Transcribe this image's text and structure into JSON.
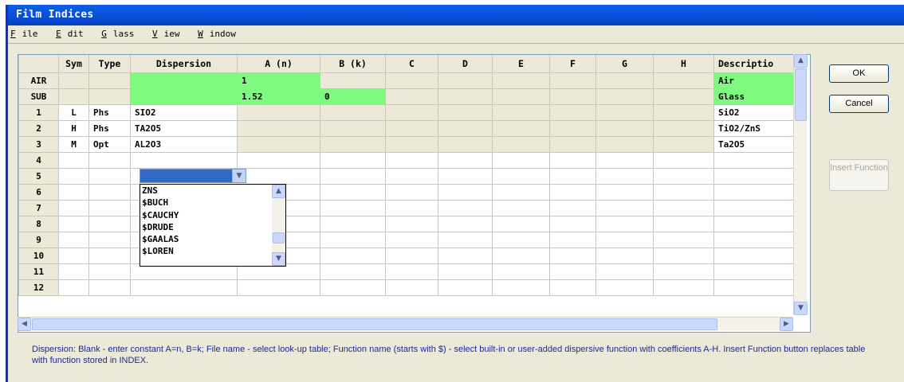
{
  "window": {
    "title": "Film Indices"
  },
  "menu": [
    {
      "key": "F",
      "rest": "ile"
    },
    {
      "key": "E",
      "rest": "dit"
    },
    {
      "key": "G",
      "rest": "lass"
    },
    {
      "key": "V",
      "rest": "iew"
    },
    {
      "key": "W",
      "rest": "indow"
    }
  ],
  "table": {
    "headers": [
      "",
      "Sym",
      "Type",
      "Dispersion",
      "A (n)",
      "B (k)",
      "C",
      "D",
      "E",
      "F",
      "G",
      "H",
      "Descriptio"
    ],
    "rows": [
      {
        "label": "AIR",
        "sym": "",
        "type": "",
        "dispersion": "",
        "a": "1",
        "b": "",
        "desc": "Air"
      },
      {
        "label": "SUB",
        "sym": "",
        "type": "",
        "dispersion": "",
        "a": "1.52",
        "b": "0",
        "desc": "Glass"
      },
      {
        "label": "1",
        "sym": "L",
        "type": "Phs",
        "dispersion": "SIO2",
        "a": "",
        "b": "",
        "desc": "SiO2"
      },
      {
        "label": "2",
        "sym": "H",
        "type": "Phs",
        "dispersion": "TA2O5",
        "a": "",
        "b": "",
        "desc": "TiO2/ZnS"
      },
      {
        "label": "3",
        "sym": "M",
        "type": "Opt",
        "dispersion": "AL2O3",
        "a": "",
        "b": "",
        "desc": "Ta2O5"
      },
      {
        "label": "4",
        "sym": "",
        "type": "",
        "dispersion": "",
        "a": "",
        "b": "",
        "desc": ""
      },
      {
        "label": "5",
        "sym": "",
        "type": "",
        "dispersion": "",
        "a": "",
        "b": "",
        "desc": ""
      },
      {
        "label": "6",
        "sym": "",
        "type": "",
        "dispersion": "",
        "a": "",
        "b": "",
        "desc": ""
      },
      {
        "label": "7",
        "sym": "",
        "type": "",
        "dispersion": "",
        "a": "",
        "b": "",
        "desc": ""
      },
      {
        "label": "8",
        "sym": "",
        "type": "",
        "dispersion": "",
        "a": "",
        "b": "",
        "desc": ""
      },
      {
        "label": "9",
        "sym": "",
        "type": "",
        "dispersion": "",
        "a": "",
        "b": "",
        "desc": ""
      },
      {
        "label": "10",
        "sym": "",
        "type": "",
        "dispersion": "",
        "a": "",
        "b": "",
        "desc": ""
      },
      {
        "label": "11",
        "sym": "",
        "type": "",
        "dispersion": "",
        "a": "",
        "b": "",
        "desc": ""
      },
      {
        "label": "12",
        "sym": "",
        "type": "",
        "dispersion": "",
        "a": "",
        "b": "",
        "desc": ""
      }
    ]
  },
  "dropdown": {
    "value": "",
    "options": [
      "ZNS",
      "$BUCH",
      "$CAUCHY",
      "$DRUDE",
      "$GAALAS",
      "$LOREN"
    ]
  },
  "buttons": {
    "ok": "OK",
    "cancel": "Cancel",
    "insert_function": "Insert Function"
  },
  "footer_text": "Dispersion: Blank - enter constant A=n, B=k; File name - select look-up table; Function name (starts with $) - select built-in or user-added dispersive function with coefficients A-H. Insert Function button replaces table with function stored in INDEX.",
  "colors": {
    "titlebar": "#0651d9",
    "highlight_green": "#7ff97f",
    "combo_selected": "#316ac5",
    "footer_text": "#1a2a8f"
  }
}
